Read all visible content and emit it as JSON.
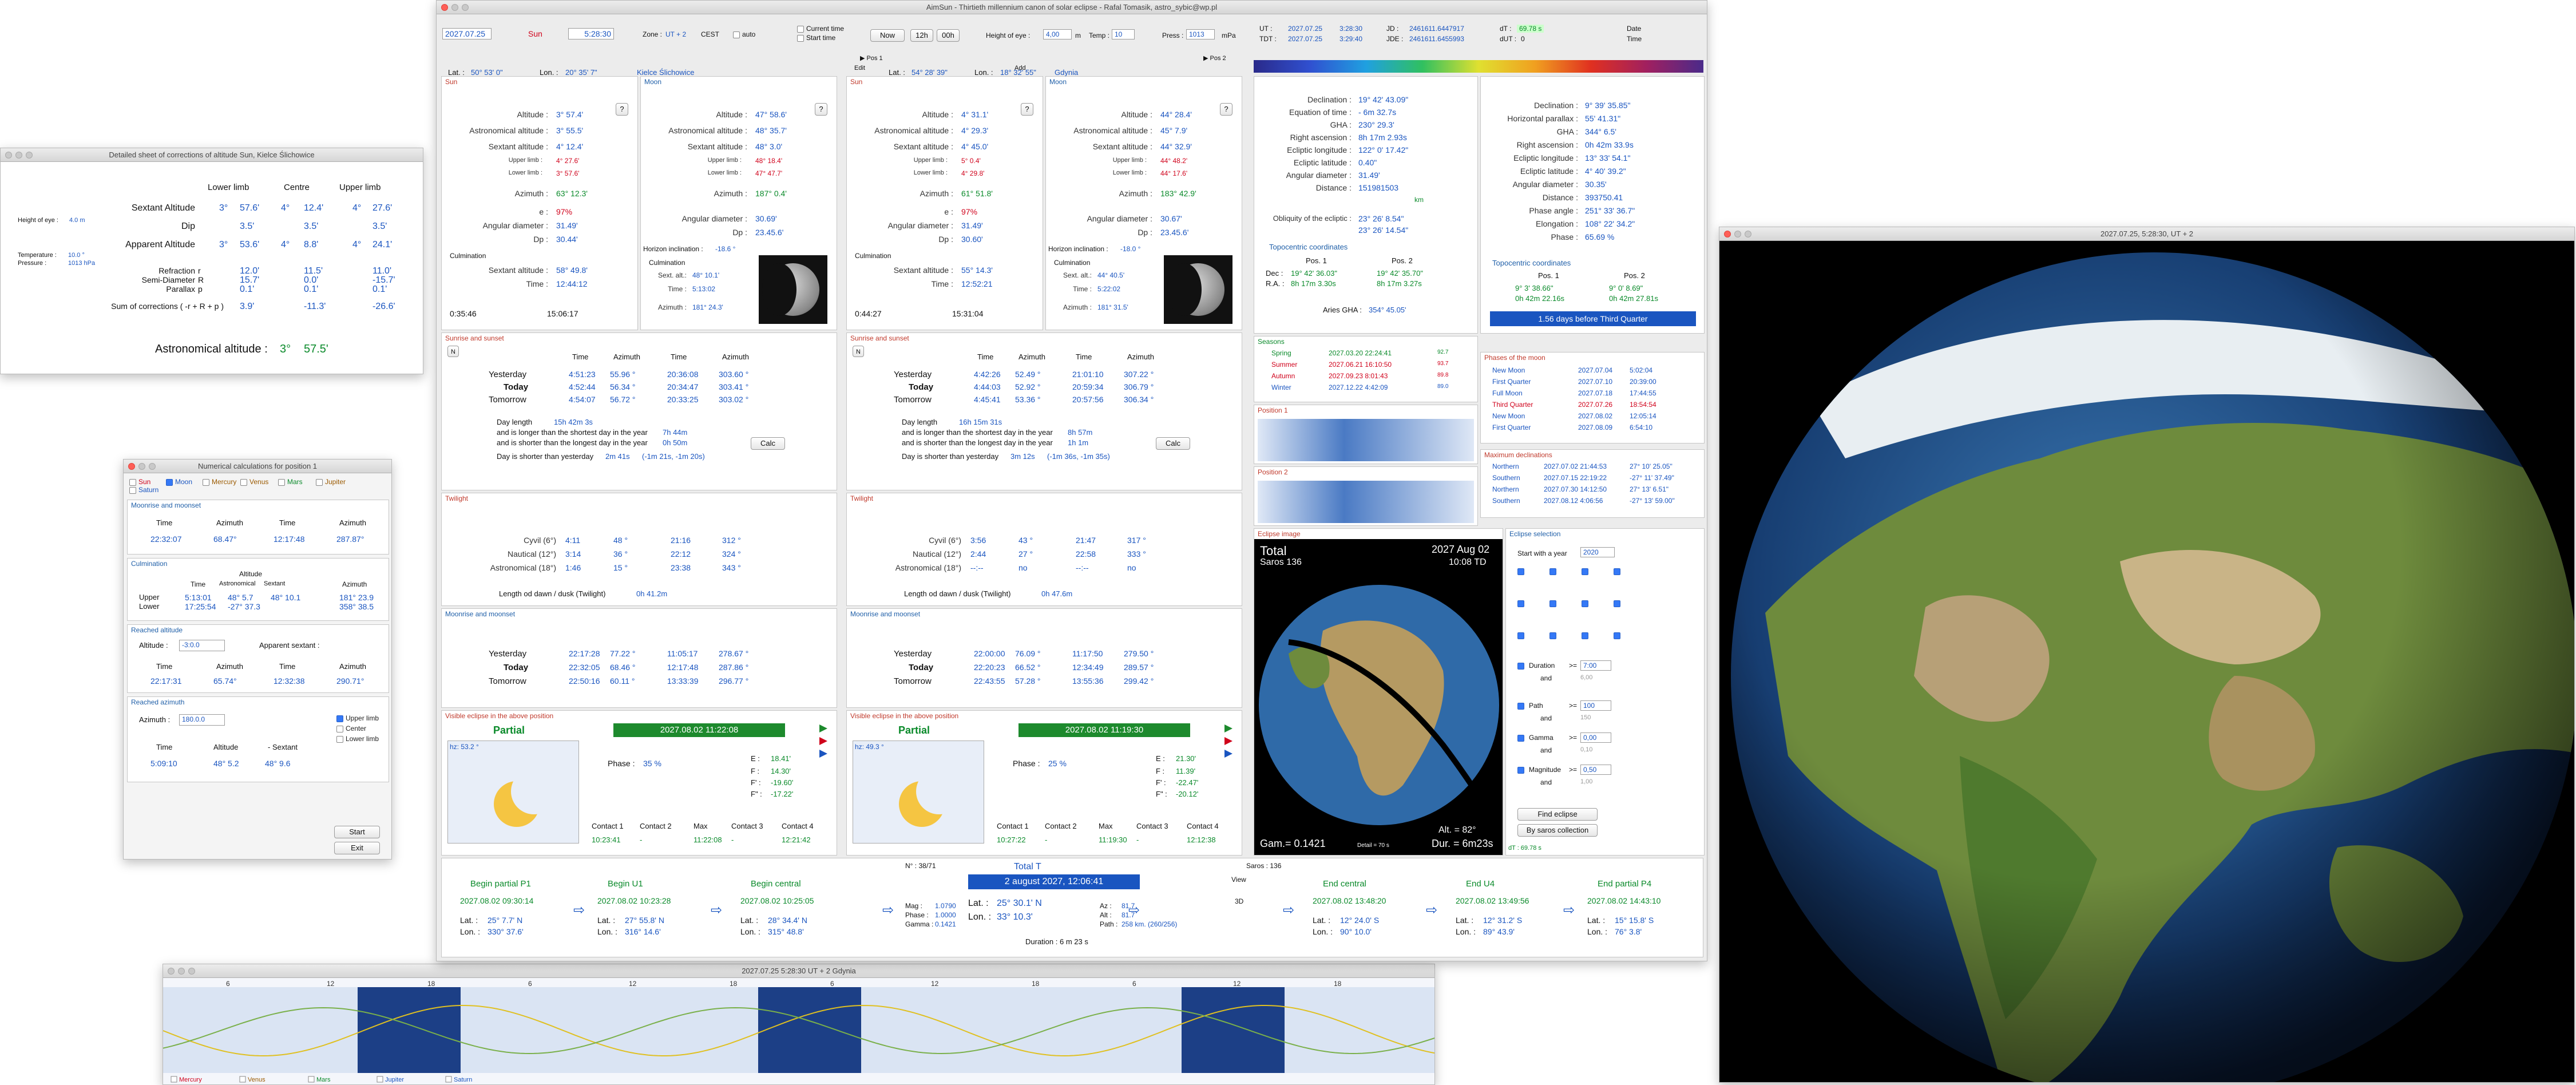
{
  "main": {
    "title": "AimSun - Thirtieth millennium canon of solar eclipse - Rafal Tomasik, astro_sybic@wp.pl",
    "date": "2027.07.25",
    "body": "Sun",
    "time": "5:28:30",
    "zone": "Zone :",
    "zone_val": "UT + 2",
    "cest": "CEST",
    "auto": "auto",
    "current_time": "Current time",
    "start_time": "Start time",
    "now": "Now",
    "h12": "12h",
    "h00": "00h",
    "height_eye": "Height of eye :",
    "height_val": "4,00",
    "m": "m",
    "temp": "Temp :",
    "temp_val": "10",
    "press": "Press :",
    "press_val": "1013",
    "mpa": "mPa",
    "lat1": "Lat. :",
    "lat1_val": "50° 53' 0\"",
    "lon1": "Lon. :",
    "lon1_val": "20° 35' 7\"",
    "city1": "Kielce Ślichowice",
    "lat2": "Lat. :",
    "lat2_val": "54° 28' 39\"",
    "lon2": "Lon. :",
    "lon2_val": "18° 32' 55\"",
    "city2": "Gdynia",
    "edit": "Edit",
    "add": "Add",
    "pos1": "Pos 1",
    "pos2": "Pos 2",
    "ut_label": "UT :",
    "ut_date": "2027.07.25",
    "ut_time": "3:28:30",
    "tdt_label": "TDT :",
    "tdt_date": "2027.07.25",
    "tdt_time": "3:29:40",
    "jd_label": "JD :",
    "jd_val": "2461611.6447917",
    "jde_label": "JDE :",
    "jde_val": "2461611.6455993",
    "dt_label": "dT :",
    "dt_val": "69.78 s",
    "dut_label": "dUT :",
    "dut_val": "0",
    "date_btn": "Date",
    "time_btn": "Time"
  },
  "pos1": {
    "sun_header": "Sun",
    "moon_header": "Moon",
    "sun": {
      "alt": "3° 57.4'",
      "astro_alt": "3° 55.5'",
      "sext_alt": "4° 12.4'",
      "upper": "4° 27.6'",
      "lower": "3° 57.6'",
      "az": "63° 12.3'",
      "e": "97%",
      "ang_d": "31.49'",
      "dp": "30.44'",
      "cul_alt": "58° 49.8'",
      "cul_time": "12:44:12",
      "t1": "0:35:46",
      "t2": "15:06:17"
    },
    "moon": {
      "alt": "47° 58.6'",
      "astro_alt": "48° 35.7'",
      "sext_alt": "48° 3.0'",
      "upper": "48° 18.4'",
      "lower": "47° 47.7'",
      "az": "187° 0.4'",
      "ang_d": "30.69'",
      "dp": "23.45.6'",
      "incl": "-18.6 °",
      "sext": "48° 10.1'",
      "time": "5:13:02",
      "az2": "181° 24.3'"
    },
    "sunrise": {
      "header": "Sunrise and sunset",
      "cols": [
        "Time",
        "Azimuth",
        "Time",
        "Azimuth"
      ],
      "rows": [
        [
          "Yesterday",
          "4:51:23",
          "55.96 °",
          "20:36:08",
          "303.60 °"
        ],
        [
          "Today",
          "4:52:44",
          "56.34 °",
          "20:34:47",
          "303.41 °"
        ],
        [
          "Tomorrow",
          "4:54:07",
          "56.72 °",
          "20:33:25",
          "303.02 °"
        ]
      ],
      "day_len": "Day length",
      "day_len_val": "15h 42m 3s",
      "longer": "and is longer than the shortest day in the year",
      "longer_val": "7h 44m",
      "shorter": "and is shorter than the longest day in the year",
      "shorter_val": "0h 50m",
      "yest": "Day is shorter than yesterday",
      "yest_val": "2m 41s",
      "yest_extra": "(-1m 21s, -1m 20s)",
      "calc": "Calc"
    },
    "twilight": {
      "header": "Twilight",
      "rows": [
        [
          "Cyvil (6°)",
          "4:11",
          "48 °",
          "21:16",
          "312 °"
        ],
        [
          "Nautical (12°)",
          "3:14",
          "36 °",
          "22:12",
          "324 °"
        ],
        [
          "Astronomical (18°)",
          "1:46",
          "15 °",
          "23:38",
          "343 °"
        ]
      ],
      "len": "Length od dawn / dusk (Twilight)",
      "len_val": "0h 41.2m"
    },
    "moonrise": {
      "header": "Moonrise and moonset",
      "rows": [
        [
          "Yesterday",
          "22:17:28",
          "77.22 °",
          "11:05:17",
          "278.67 °"
        ],
        [
          "Today",
          "22:32:05",
          "68.46 °",
          "12:17:48",
          "287.86 °"
        ],
        [
          "Tomorrow",
          "22:50:16",
          "60.11 °",
          "13:33:39",
          "296.77 °"
        ]
      ]
    },
    "eclipse": {
      "header": "Visible eclipse in the above position",
      "type": "Partial",
      "date": "2027.08.02  11:22:08",
      "hz": "hz: 53.2 °",
      "phase": "Phase :",
      "phase_val": "35 %",
      "E": "18.41'",
      "F": "14.30'",
      "F1": "-19.60'",
      "F2": "-17.22'",
      "c1": "Contact 1",
      "c2": "Contact 2",
      "max": "Max",
      "c3": "Contact 3",
      "c4": "Contact 4",
      "c1v": "10:23:41",
      "c2v": "-",
      "maxv": "11:22:08",
      "c3v": "-",
      "c4v": "12:21:42"
    }
  },
  "pos2": {
    "sun": {
      "alt": "4° 31.1'",
      "astro_alt": "4° 29.3'",
      "sext_alt": "4° 45.0'",
      "upper": "5° 0.4'",
      "lower": "4° 29.8'",
      "az": "61° 51.8'",
      "e": "97%",
      "ang_d": "31.49'",
      "dp": "30.60'",
      "cul_alt": "55° 14.3'",
      "cul_time": "12:52:21",
      "t1": "0:44:27",
      "t2": "15:31:04"
    },
    "moon": {
      "alt": "44° 28.4'",
      "astro_alt": "45° 7.9'",
      "sext_alt": "44° 32.9'",
      "upper": "44° 48.2'",
      "lower": "44° 17.6'",
      "az": "183° 42.9'",
      "ang_d": "30.67'",
      "dp": "23.45.6'",
      "incl": "-18.0 °",
      "sext": "44° 40.5'",
      "time": "5:22:02",
      "az2": "181° 31.5'"
    },
    "sunrise": {
      "rows": [
        [
          "Yesterday",
          "4:42:26",
          "52.49 °",
          "21:01:10",
          "307.22 °"
        ],
        [
          "Today",
          "4:44:03",
          "52.92 °",
          "20:59:34",
          "306.79 °"
        ],
        [
          "Tomorrow",
          "4:45:41",
          "53.36 °",
          "20:57:56",
          "306.34 °"
        ]
      ],
      "day_len_val": "16h 15m 31s",
      "longer_val": "8h 57m",
      "shorter_val": "1h 1m",
      "yest_val": "3m 12s",
      "yest_extra": "(-1m 36s, -1m 35s)"
    },
    "twilight": {
      "rows": [
        [
          "Cyvil (6°)",
          "3:56",
          "43 °",
          "21:47",
          "317 °"
        ],
        [
          "Nautical (12°)",
          "2:44",
          "27 °",
          "22:58",
          "333 °"
        ],
        [
          "Astronomical (18°)",
          "--:--",
          "no",
          "--:--",
          "no"
        ]
      ],
      "len_val": "0h 47.6m"
    },
    "moonrise": {
      "rows": [
        [
          "Yesterday",
          "22:00:00",
          "76.09 °",
          "11:17:50",
          "279.50 °"
        ],
        [
          "Today",
          "22:20:23",
          "66.52 °",
          "12:34:49",
          "289.57 °"
        ],
        [
          "Tomorrow",
          "22:43:55",
          "57.28 °",
          "13:55:36",
          "299.42 °"
        ]
      ]
    },
    "eclipse": {
      "type": "Partial",
      "date": "2027.08.02  11:19:30",
      "hz": "hz: 49.3 °",
      "phase_val": "25 %",
      "E": "21.30'",
      "F": "11.39'",
      "F1": "-22.47'",
      "F2": "-20.12'",
      "c1v": "10:27:22",
      "c2v": "-",
      "maxv": "11:19:30",
      "c3v": "-",
      "c4v": "12:12:38",
      "view": "View"
    }
  },
  "right": {
    "sun": {
      "decl": "19° 42' 43.09\"",
      "eq": "- 6m 32.7s",
      "gha": "230° 29.3'",
      "ra": "8h 17m  2.93s",
      "ecl_lon": "122° 0' 17.42\"",
      "ecl_lat": "0.40\"",
      "ang_d": "31.49'",
      "dist": "151981503",
      "dist_u": "km",
      "obl": "23° 26' 8.54\"",
      "obl2": "23° 26' 14.54\"",
      "topo": "Topocentric coordinates",
      "pos1": "Pos. 1",
      "pos2": "Pos. 2",
      "dec1": "19° 42' 36.03\"",
      "dec2": "19° 42' 35.70\"",
      "ra1": "8h 17m  3.30s",
      "ra2": "8h 17m  3.27s",
      "aries": "Aries GHA :",
      "aries_val": "354° 45.05'"
    },
    "moon": {
      "decl": "9° 39' 35.85\"",
      "hp": "55' 41.31\"",
      "gha": "344° 6.5'",
      "ra": "0h 42m 33.9s",
      "ecl_lon": "13° 33' 54.1\"",
      "ecl_lat": "4° 40' 39.2\"",
      "ang_d": "30.35'",
      "dist": "393750.41",
      "phase_angle": "251° 33' 36.7\"",
      "elong": "108° 22' 34.2\"",
      "phase": "65.69 %",
      "dec1": "9° 3' 38.66\"",
      "dec2": "9° 0' 8.69\"",
      "ra1": "0h 42m 22.16s",
      "ra2": "0h 42m 27.81s",
      "quarter": "1.56 days before Third Quarter"
    },
    "seasons": {
      "header": "Seasons",
      "rows": [
        [
          "Spring",
          "2027.03.20  22:24:41",
          "92.7"
        ],
        [
          "Summer",
          "2027.06.21  16:10:50",
          "93.7"
        ],
        [
          "Autumn",
          "2027.09.23  8:01:43",
          "89.8"
        ],
        [
          "Winter",
          "2027.12.22  4:42:09",
          "89.0"
        ]
      ]
    },
    "phases": {
      "header": "Phases of the moon",
      "rows": [
        [
          "New Moon",
          "2027.07.04",
          "5:02:04"
        ],
        [
          "First Quarter",
          "2027.07.10",
          "20:39:00"
        ],
        [
          "Full Moon",
          "2027.07.18",
          "17:44:55"
        ],
        [
          "Third Quarter",
          "2027.07.26",
          "18:54:54"
        ],
        [
          "New Moon",
          "2027.08.02",
          "12:05:14"
        ],
        [
          "First Quarter",
          "2027.08.09",
          "6:54:10"
        ]
      ]
    },
    "decl": {
      "header": "Maximum declinations",
      "rows": [
        [
          "Northern",
          "2027.07.02  21:44:53",
          "27° 10' 25.05\""
        ],
        [
          "Southern",
          "2027.07.15  22:19:22",
          "-27° 11' 37.49\""
        ],
        [
          "Northern",
          "2027.07.30  14:12:50",
          "27° 13' 6.51\""
        ],
        [
          "Southern",
          "2027.08.12  4:06:56",
          "-27° 13' 59.00\""
        ]
      ]
    },
    "pos1_hdr": "Position 1",
    "pos2_hdr": "Position 2",
    "eimg": {
      "header": "Eclipse image",
      "type": "Total",
      "date": "2027 Aug 02",
      "saros": "Saros 136",
      "td": "10:08 TD",
      "gam": "Gam.= 0.1421",
      "alt": "Alt. = 82°",
      "dur": "Dur. = 6m23s",
      "detail": "Detail = 70 s"
    },
    "esel": {
      "header": "Eclipse selection",
      "start": "Start with a year",
      "year": "2020",
      "duration": "Duration",
      "d_op": ">=",
      "d_val": "7:00",
      "path": "Path",
      "p_op": ">=",
      "p_val": "100",
      "gamma": "Gamma",
      "g_op": ">=",
      "g_val": "0,00",
      "mag": "Magnitude",
      "m_op": ">=",
      "m_val": "0,50",
      "and": "and",
      "and_vals": [
        "6,00",
        "150",
        "0,10",
        "1,00"
      ],
      "find": "Find eclipse",
      "saros": "By saros collection",
      "dt": "dT : 69.78 s"
    }
  },
  "bottom": {
    "begin_partial": "Begin partial  P1",
    "bp_date": "2027.08.02  09:30:14",
    "bp_lat": "25° 7.7' N",
    "bp_lon": "330° 37.6'",
    "begin_u1": "Begin  U1",
    "u1_date": "2027.08.02  10:23:28",
    "u1_lat": "27° 55.8' N",
    "u1_lon": "316° 14.6'",
    "begin_central": "Begin central",
    "bc_date": "2027.08.02  10:25:05",
    "bc_lat": "28° 34.4' N",
    "bc_lon": "315° 48.8'",
    "n": "N° :  38/71",
    "total": "Total  T",
    "saros": "Saros : 136",
    "date": "2 august 2027,  12:06:41",
    "mag": "1.0790",
    "phase": "1.0000",
    "gamma": "0.1421",
    "c_lat": "25° 30.1' N",
    "c_lon": "33° 10.3'",
    "az": "81.7",
    "alt": "81.7",
    "path": "258 km. (260/256)",
    "duration": "Duration :  6 m 23 s",
    "view": "View",
    "threeD": "3D",
    "end_central": "End central",
    "ec_date": "2027.08.02  13:48:20",
    "ec_lat": "12° 24.0' S",
    "ec_lon": "90° 10.0'",
    "end_u4": "End  U4",
    "u4_date": "2027.08.02  13:49:56",
    "u4_lat": "12° 31.2' S",
    "u4_lon": "89° 43.9'",
    "end_partial": "End partial  P4",
    "ep_date": "2027.08.02  14:43:10",
    "ep_lat": "15° 15.8' S",
    "ep_lon": "76° 3.8'",
    "lat": "Lat. :",
    "lon": "Lon. :",
    "mag_l": "Mag :",
    "phase_l": "Phase :",
    "gamma_l": "Gamma :",
    "az_l": "Az :",
    "alt_l": "Alt :",
    "path_l": "Path :"
  },
  "corr": {
    "title": "Detailed sheet of corrections of altitude Sun, Kielce Ślichowice",
    "lower": "Lower limb",
    "centre": "Centre",
    "upper": "Upper limb",
    "height": "Height of eye :",
    "height_val": "4.0 m",
    "temp": "Temperature :",
    "temp_val": "10.0 °",
    "press": "Pressure :",
    "press_val": "1013 hPa",
    "rows": [
      [
        "Sextant Altitude",
        "",
        "3°",
        "57.6'",
        "4°",
        "12.4'",
        "4°",
        "27.6'"
      ],
      [
        "Dip",
        "",
        "",
        "3.5'",
        "",
        "3.5'",
        "",
        "3.5'"
      ],
      [
        "Apparent Altitude",
        "",
        "3°",
        "53.6'",
        "4°",
        "8.8'",
        "4°",
        "24.1'"
      ],
      [
        "Refraction",
        "r",
        "",
        "12.0'",
        "",
        "11.5'",
        "",
        "11.0'"
      ],
      [
        "Semi-Diameter",
        "R",
        "",
        "15.7'",
        "",
        "0.0'",
        "",
        "-15.7'"
      ],
      [
        "Parallax",
        "p",
        "",
        "0.1'",
        "",
        "0.1'",
        "",
        "0.1'"
      ],
      [
        "Sum of corrections  ( -r + R + p )",
        "",
        "",
        "3.9'",
        "",
        "-11.3'",
        "",
        "-26.6'"
      ]
    ],
    "astro": "Astronomical altitude :",
    "astro_deg": "3°",
    "astro_min": "57.5'"
  },
  "num": {
    "title": "Numerical calculations for position 1",
    "bodies": [
      "Sun",
      "Moon",
      "Mercury",
      "Venus",
      "Mars",
      "Jupiter",
      "Saturn"
    ],
    "mr_header": "Moonrise and moonset",
    "cols": [
      "Time",
      "Azimuth",
      "Time",
      "Azimuth"
    ],
    "mr": [
      "22:32:07",
      "68.47°",
      "12:17:48",
      "287.87°"
    ],
    "cul_header": "Culmination",
    "alt": "Altitude",
    "astronomical": "Astronomical",
    "sextant": "Sextant",
    "upper": "Upper",
    "lower": "Lower",
    "cul_up": [
      "5:13:01",
      "48° 5.7",
      "48° 10.1",
      "181° 23.9"
    ],
    "cul_lo": [
      "17:25:54",
      "-27° 37.3",
      "",
      "358° 38.5"
    ],
    "ra_header": "Reached altitude",
    "altitude": "Altitude :",
    "alt_val": "-3:0.0",
    "app": "Apparent sextant :",
    "ra": [
      "22:17:31",
      "65.74°",
      "12:32:38",
      "290.71°"
    ],
    "raz_header": "Reached azimuth",
    "azimuth": "Azimuth :",
    "az_val": "180.0.0",
    "limb": [
      "Upper limb",
      "Center",
      "Lower limb"
    ],
    "raz_cols": [
      "Time",
      "Altitude",
      "- Sextant"
    ],
    "raz": [
      "5:09:10",
      "48° 5.2",
      "48° 9.6"
    ],
    "start": "Start",
    "exit": "Exit"
  },
  "timeline": {
    "title": "2027.07.25   5:28:30   UT + 2   Gdynia",
    "ticks": [
      "6",
      "12",
      "18",
      "6",
      "12",
      "18",
      "6",
      "12",
      "18",
      "6",
      "12",
      "18"
    ],
    "legend": [
      "Mercury",
      "Venus",
      "Mars",
      "Jupiter",
      "Saturn"
    ]
  },
  "globe": {
    "title": "2027.07.25,   5:28:30,   UT + 2"
  }
}
